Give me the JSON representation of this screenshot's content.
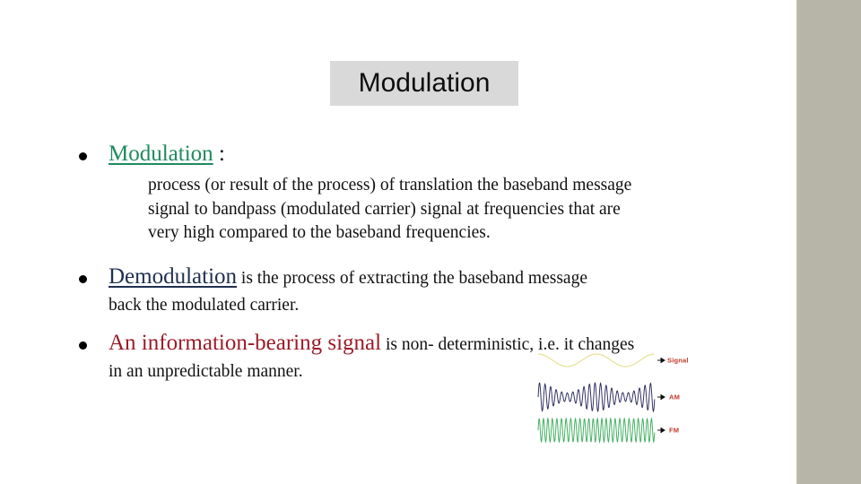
{
  "slide": {
    "title": "Modulation",
    "background_color": "#ffffff",
    "title_box_color": "#d9d9d9",
    "right_panel_color": "#b7b5a8"
  },
  "colors": {
    "green_heading": "#1f8a5e",
    "navy_heading": "#1f3050",
    "red_heading": "#9b1b28",
    "body_text": "#111111",
    "signal_wave": "#e8e39a",
    "am_wave": "#2a2a5e",
    "fm_wave": "#3fae5e",
    "wave_label": "#c0392b"
  },
  "bullets": [
    {
      "id": "bullet-modulation",
      "heading": "Modulation",
      "heading_style": "green-underline",
      "trailing": " :",
      "paragraph_lines": [
        "process (or result of the process) of  translation the baseband message",
        "signal to  bandpass (modulated carrier) signal at frequencies  that are",
        "very high compared to the baseband  frequencies."
      ]
    },
    {
      "id": "bullet-demodulation",
      "heading": "Demodulation",
      "heading_style": "navy-underline",
      "trailing": " is the process of extracting the  baseband message",
      "paragraph_lines": [
        "back the modulated carrier."
      ]
    },
    {
      "id": "bullet-information-bearing-signal",
      "heading": "An information-bearing signal",
      "heading_style": "red",
      "trailing": " is non-  deterministic, i.e. it changes",
      "paragraph_lines": [
        "in an unpredictable  manner."
      ]
    }
  ],
  "figure": {
    "name": "modulation-waveforms",
    "waveforms": [
      {
        "label": "Signal",
        "type": "sine",
        "color": "#e8e39a"
      },
      {
        "label": "AM",
        "type": "amplitude-modulated",
        "color": "#2a2a5e"
      },
      {
        "label": "FM",
        "type": "frequency-modulated",
        "color": "#3fae5e"
      }
    ]
  }
}
